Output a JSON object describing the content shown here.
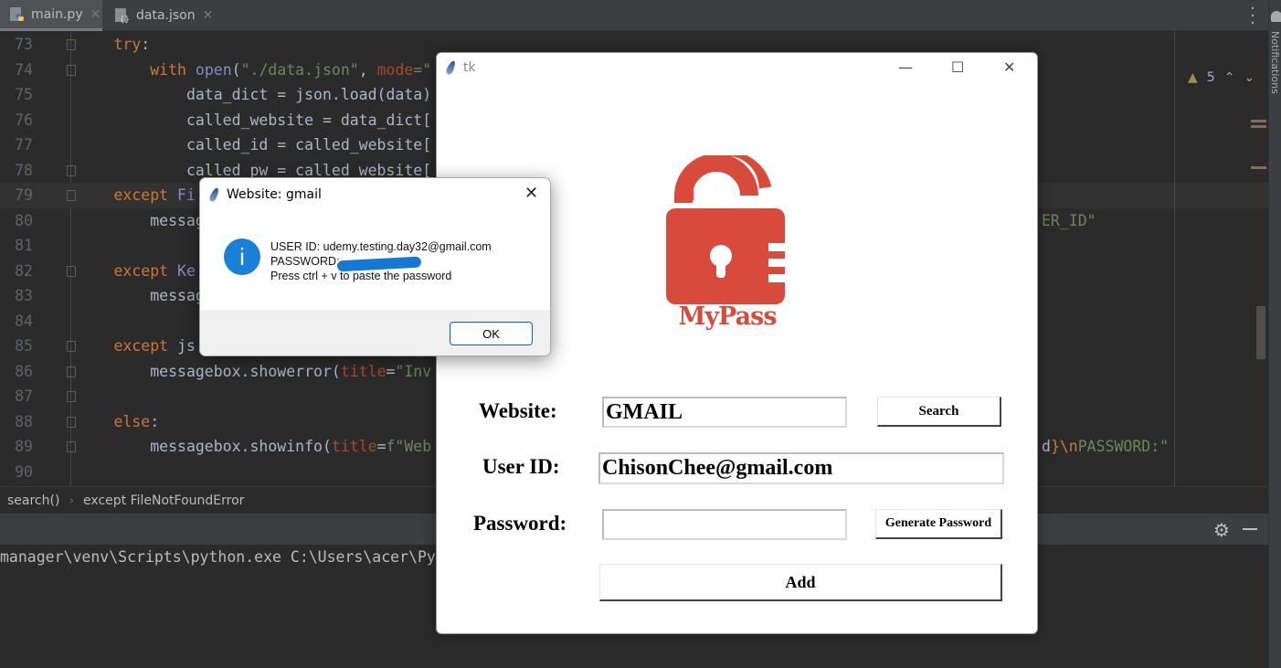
{
  "tabs": [
    {
      "label": "main.py",
      "active": true
    },
    {
      "label": "data.json",
      "active": false
    }
  ],
  "editor": {
    "current_line": 79,
    "lines": [
      {
        "n": "73",
        "segs": [
          {
            "t": "        try",
            "c": "kw"
          },
          {
            "t": ":",
            "c": "tx"
          }
        ]
      },
      {
        "n": "74",
        "segs": [
          {
            "t": "            with ",
            "c": "kw"
          },
          {
            "t": "open",
            "c": "fn"
          },
          {
            "t": "(",
            "c": "tx"
          },
          {
            "t": "\"./data.json\"",
            "c": "str"
          },
          {
            "t": ", ",
            "c": "tx"
          },
          {
            "t": "mode",
            "c": "prm"
          },
          {
            "t": "=\"",
            "c": "str"
          }
        ]
      },
      {
        "n": "75",
        "segs": [
          {
            "t": "                data_dict = json.load(data)",
            "c": "tx"
          }
        ]
      },
      {
        "n": "76",
        "segs": [
          {
            "t": "                called_website = data_dict[",
            "c": "tx"
          }
        ]
      },
      {
        "n": "77",
        "segs": [
          {
            "t": "                called_id = called_website[",
            "c": "tx"
          }
        ]
      },
      {
        "n": "78",
        "segs": [
          {
            "t": "                called_pw = called_website[",
            "c": "tx"
          }
        ]
      },
      {
        "n": "79",
        "segs": [
          {
            "t": "        except ",
            "c": "kw"
          },
          {
            "t": "Fi",
            "c": "fn"
          }
        ]
      },
      {
        "n": "80",
        "segs": [
          {
            "t": "            messag",
            "c": "tx"
          }
        ],
        "right": [
          {
            "t": "ER_ID\"",
            "c": "str"
          }
        ]
      },
      {
        "n": "81",
        "segs": []
      },
      {
        "n": "82",
        "segs": [
          {
            "t": "        except ",
            "c": "kw"
          },
          {
            "t": "Ke",
            "c": "fn"
          }
        ]
      },
      {
        "n": "83",
        "segs": [
          {
            "t": "            messag",
            "c": "tx"
          }
        ]
      },
      {
        "n": "84",
        "segs": []
      },
      {
        "n": "85",
        "segs": [
          {
            "t": "        except ",
            "c": "kw"
          },
          {
            "t": "js",
            "c": "tx"
          }
        ]
      },
      {
        "n": "86",
        "segs": [
          {
            "t": "            messagebox.showerror(",
            "c": "tx"
          },
          {
            "t": "title",
            "c": "prm"
          },
          {
            "t": "=",
            "c": "tx"
          },
          {
            "t": "\"Inv",
            "c": "str"
          }
        ]
      },
      {
        "n": "87",
        "segs": []
      },
      {
        "n": "88",
        "segs": [
          {
            "t": "        else",
            "c": "kw"
          },
          {
            "t": ":",
            "c": "tx"
          }
        ]
      },
      {
        "n": "89",
        "segs": [
          {
            "t": "            messagebox.showinfo(",
            "c": "tx"
          },
          {
            "t": "title",
            "c": "prm"
          },
          {
            "t": "=",
            "c": "tx"
          },
          {
            "t": "f\"Web",
            "c": "str"
          }
        ],
        "right": [
          {
            "t": "d",
            "c": "tx"
          },
          {
            "t": "}\\n",
            "c": "kw"
          },
          {
            "t": "PASSWORD:\"",
            "c": "str"
          }
        ]
      },
      {
        "n": "90",
        "segs": []
      }
    ]
  },
  "inspections": {
    "warnings": "5"
  },
  "notifications_label": "Notifications",
  "breadcrumb": [
    "search()",
    "except FileNotFoundError"
  ],
  "console": {
    "text": "manager\\venv\\Scripts\\python.exe C:\\Users\\acer\\Py"
  },
  "tk_window": {
    "title": "tk",
    "logo_text": "MyPass",
    "logo_color": "#d74a3c",
    "website_label": "Website:",
    "website_value": "GMAIL",
    "search_label": "Search",
    "userid_label": "User ID:",
    "userid_value": "ChisonChee@gmail.com",
    "password_label": "Password:",
    "password_value": "",
    "generate_label": "Generate Password",
    "add_label": "Add"
  },
  "dialog": {
    "title": "Website: gmail",
    "line1": "USER ID: udemy.testing.day32@gmail.com",
    "line2": "PASSWORD:",
    "line3": "Press ctrl + v to paste the password",
    "ok_label": "OK"
  }
}
